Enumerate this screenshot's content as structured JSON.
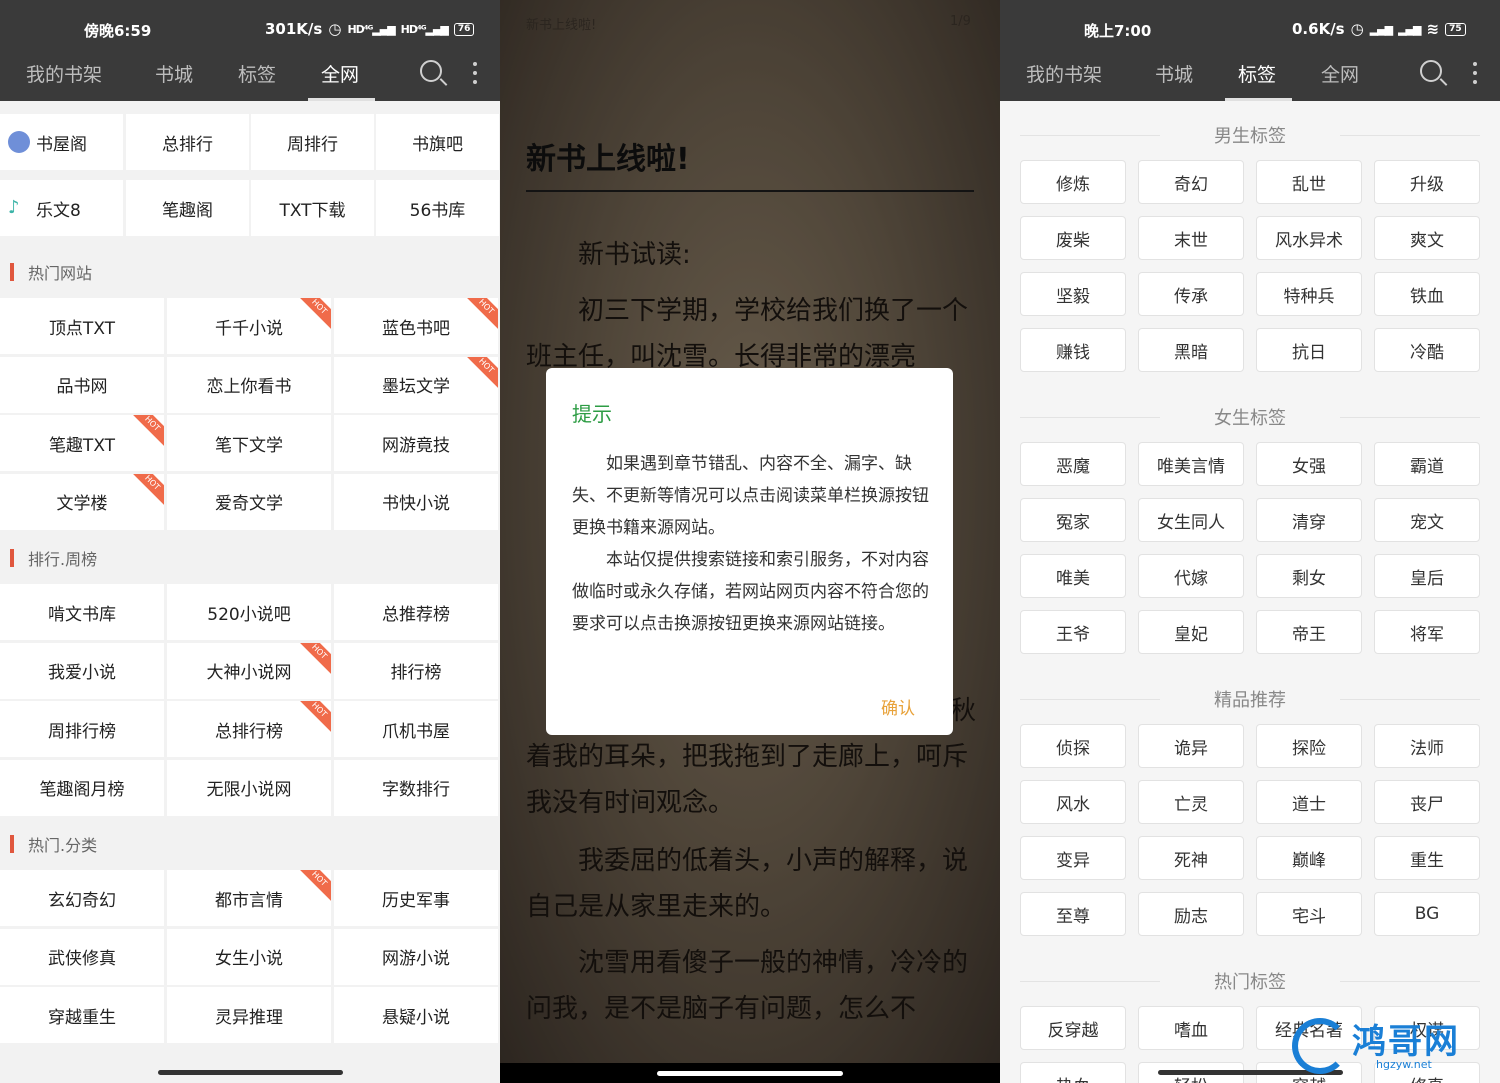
{
  "left": {
    "status": {
      "time": "傍晚6:59",
      "speed": "301K/s",
      "battery": "76"
    },
    "nav": {
      "tabs": [
        "我的书架",
        "书城",
        "标签",
        "全网"
      ],
      "active": 3
    },
    "top_sites": [
      {
        "label": "书屋阁",
        "icon": "grid-icon"
      },
      {
        "label": "总排行"
      },
      {
        "label": "周排行"
      },
      {
        "label": "书旗吧"
      },
      {
        "label": "乐文8",
        "icon": "leaf-icon"
      },
      {
        "label": "笔趣阁"
      },
      {
        "label": "TXT下载"
      },
      {
        "label": "56书库"
      }
    ],
    "sections": [
      {
        "title": "热门网站",
        "items": [
          {
            "label": "顶点TXT"
          },
          {
            "label": "千千小说",
            "hot": true
          },
          {
            "label": "蓝色书吧",
            "hot": true
          },
          {
            "label": "品书网"
          },
          {
            "label": "恋上你看书"
          },
          {
            "label": "墨坛文学",
            "hot": true
          },
          {
            "label": "笔趣TXT",
            "hot": true
          },
          {
            "label": "笔下文学"
          },
          {
            "label": "网游竟技"
          },
          {
            "label": "文学楼",
            "hot": true
          },
          {
            "label": "爱奇文学"
          },
          {
            "label": "书快小说"
          }
        ]
      },
      {
        "title": "排行.周榜",
        "items": [
          {
            "label": "啃文书库"
          },
          {
            "label": "520小说吧"
          },
          {
            "label": "总推荐榜"
          },
          {
            "label": "我爱小说"
          },
          {
            "label": "大神小说网",
            "hot": true
          },
          {
            "label": "排行榜"
          },
          {
            "label": "周排行榜"
          },
          {
            "label": "总排行榜",
            "hot": true
          },
          {
            "label": "爪机书屋"
          },
          {
            "label": "笔趣阁月榜"
          },
          {
            "label": "无限小说网"
          },
          {
            "label": "字数排行"
          }
        ]
      },
      {
        "title": "热门.分类",
        "items": [
          {
            "label": "玄幻奇幻"
          },
          {
            "label": "都市言情",
            "hot": true
          },
          {
            "label": "历史军事"
          },
          {
            "label": "武侠修真"
          },
          {
            "label": "女生小说"
          },
          {
            "label": "网游小说"
          },
          {
            "label": "穿越重生"
          },
          {
            "label": "灵异推理"
          },
          {
            "label": "悬疑小说"
          }
        ]
      }
    ],
    "hot_badge": "HOT"
  },
  "middle": {
    "header_title": "新书上线啦!",
    "page_indicator": "1/9",
    "chapter_title": "新书上线啦!",
    "paragraphs": [
      "新书试读:",
      "初三下学期，学校给我们换了一个班主任，叫沈雪。长得非常的漂亮",
      "着我的耳朵，把我拖到了走廊上，呵斥我没有时间观念。",
      "我委屈的低着头，小声的解释，说自己是从家里走来的。",
      "沈雪用看傻子一般的神情，冷冷的问我，是不是脑子有问题，怎么不"
    ],
    "dialog": {
      "title": "提示",
      "body": [
        "如果遇到章节错乱、内容不全、漏字、缺失、不更新等情况可以点击阅读菜单栏换源按钮更换书籍来源网站。",
        "本站仅提供搜索链接和索引服务，不对内容做临时或永久存储，若网站网页内容不符合您的要求可以点击换源按钮更换来源网站链接。"
      ],
      "confirm": "确认"
    }
  },
  "right": {
    "status": {
      "time": "晚上7:00",
      "speed": "0.6K/s",
      "battery": "75"
    },
    "nav": {
      "tabs": [
        "我的书架",
        "书城",
        "标签",
        "全网"
      ],
      "active": 2
    },
    "groups": [
      {
        "title": "男生标签",
        "tags": [
          "修炼",
          "奇幻",
          "乱世",
          "升级",
          "废柴",
          "末世",
          "风水异术",
          "爽文",
          "坚毅",
          "传承",
          "特种兵",
          "铁血",
          "赚钱",
          "黑暗",
          "抗日",
          "冷酷"
        ]
      },
      {
        "title": "女生标签",
        "tags": [
          "恶魔",
          "唯美言情",
          "女强",
          "霸道",
          "冤家",
          "女生同人",
          "清穿",
          "宠文",
          "唯美",
          "代嫁",
          "剩女",
          "皇后",
          "王爷",
          "皇妃",
          "帝王",
          "将军"
        ]
      },
      {
        "title": "精品推荐",
        "tags": [
          "侦探",
          "诡异",
          "探险",
          "法师",
          "风水",
          "亡灵",
          "道士",
          "丧尸",
          "变异",
          "死神",
          "巅峰",
          "重生",
          "至尊",
          "励志",
          "宅斗",
          "BG"
        ]
      },
      {
        "title": "热门标签",
        "tags": [
          "反穿越",
          "嗜血",
          "经典名著",
          "权谋",
          "热血",
          "轻松",
          "穿越",
          "修真"
        ]
      }
    ],
    "watermark": {
      "name": "鸿哥网",
      "url": "hgzyw.net"
    }
  }
}
